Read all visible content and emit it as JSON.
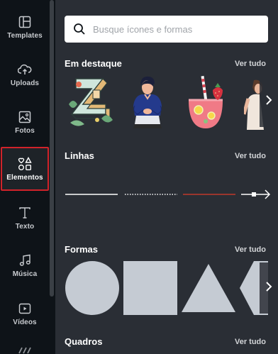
{
  "sidebar": {
    "items": [
      {
        "label": "Templates",
        "icon": "templates-icon"
      },
      {
        "label": "Uploads",
        "icon": "cloud-upload-icon"
      },
      {
        "label": "Fotos",
        "icon": "photo-icon"
      },
      {
        "label": "Elementos",
        "icon": "shapes-icon",
        "active": true
      },
      {
        "label": "Texto",
        "icon": "text-icon"
      },
      {
        "label": "Música",
        "icon": "music-note-icon"
      },
      {
        "label": "Vídeos",
        "icon": "video-icon"
      }
    ],
    "active_color": "#d1232a"
  },
  "search": {
    "placeholder": "Busque ícones e formas"
  },
  "sections": {
    "featured": {
      "title": "Em destaque",
      "see_all": "Ver tudo"
    },
    "lines": {
      "title": "Linhas",
      "see_all": "Ver tudo"
    },
    "shapes": {
      "title": "Formas",
      "see_all": "Ver tudo"
    },
    "frames": {
      "title": "Quadros",
      "see_all": "Ver tudo"
    }
  },
  "colors": {
    "panel_bg": "#2a2e35",
    "sidebar_bg": "#0e1318",
    "shape_fill": "#c5cbd3",
    "red_line": "#c0392b"
  }
}
